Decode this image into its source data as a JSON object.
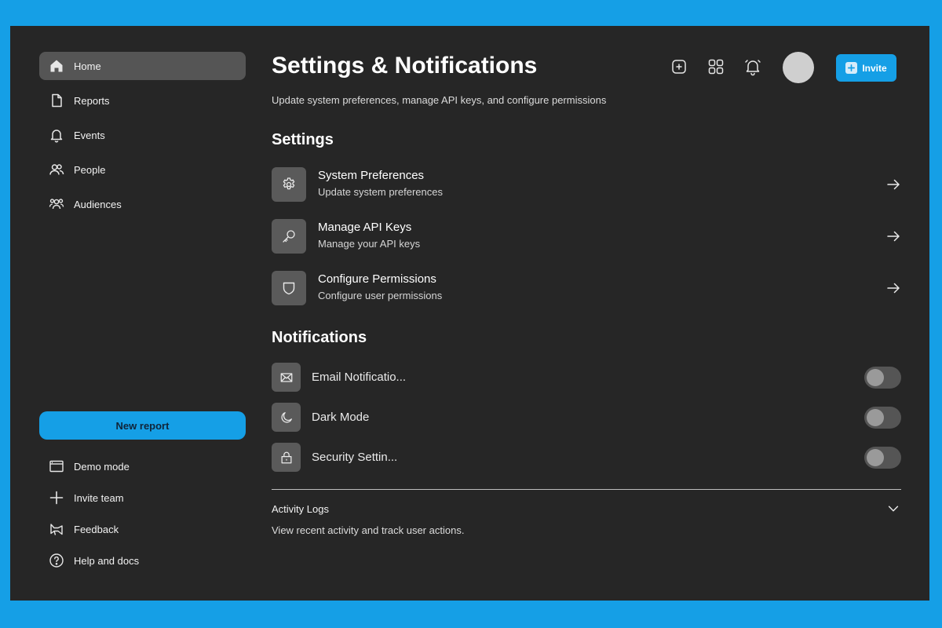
{
  "sidebar": {
    "items": [
      {
        "label": "Home",
        "icon": "home-icon",
        "active": true
      },
      {
        "label": "Reports",
        "icon": "file-icon"
      },
      {
        "label": "Events",
        "icon": "bell-icon"
      },
      {
        "label": "People",
        "icon": "users-icon"
      },
      {
        "label": "Audiences",
        "icon": "audience-icon"
      }
    ],
    "new_report_label": "New report",
    "footer": [
      {
        "label": "Demo mode",
        "icon": "window-icon"
      },
      {
        "label": "Invite team",
        "icon": "plus-icon"
      },
      {
        "label": "Feedback",
        "icon": "megaphone-icon"
      },
      {
        "label": "Help and docs",
        "icon": "help-circle-icon"
      }
    ]
  },
  "header": {
    "title": "Settings & Notifications",
    "subtitle": "Update system preferences, manage API keys, and configure permissions",
    "invite_label": "Invite"
  },
  "settings": {
    "title": "Settings",
    "items": [
      {
        "name": "System Preferences",
        "desc": "Update system preferences",
        "icon": "gear-icon"
      },
      {
        "name": "Manage API Keys",
        "desc": "Manage your API keys",
        "icon": "key-icon"
      },
      {
        "name": "Configure Permissions",
        "desc": "Configure user permissions",
        "icon": "shield-icon"
      }
    ]
  },
  "notifications": {
    "title": "Notifications",
    "items": [
      {
        "name": "Email Notificatio...",
        "icon": "mail-icon",
        "enabled": false
      },
      {
        "name": "Dark Mode",
        "icon": "moon-icon",
        "enabled": false
      },
      {
        "name": "Security Settin...",
        "icon": "lock-icon",
        "enabled": false
      }
    ]
  },
  "activity": {
    "title": "Activity Logs",
    "desc": "View recent activity and track user actions."
  },
  "colors": {
    "accent": "#159fe6",
    "background": "#262626",
    "active_item": "#555555",
    "tile": "#5a5a5a"
  }
}
